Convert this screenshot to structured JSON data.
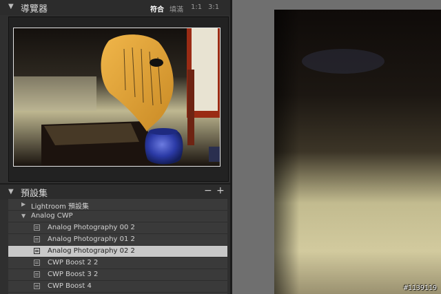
{
  "navigator": {
    "title": "導覽器",
    "zoom_options": [
      "符合",
      "填滿",
      "1:1",
      "3:1"
    ],
    "active_zoom": "符合"
  },
  "presets": {
    "title": "預設集",
    "remove_label": "−",
    "add_label": "+",
    "folders": [
      {
        "label": "Lightroom 預設集",
        "expanded": false
      },
      {
        "label": "Analog CWP",
        "expanded": true
      }
    ],
    "items": [
      {
        "label": "Analog Photography 00 2",
        "selected": false
      },
      {
        "label": "Analog Photography 01 2",
        "selected": false
      },
      {
        "label": "Analog Photography 02 2",
        "selected": true
      },
      {
        "label": "CWP Boost 2 2",
        "selected": false
      },
      {
        "label": "CWP Boost 3 2",
        "selected": false
      },
      {
        "label": "CWP Boost 4",
        "selected": false
      }
    ]
  },
  "watermark": "#1139119",
  "colors": {
    "panel_bg": "#2f2f2f",
    "selected_row": "#c8c8c8",
    "canvas_bg": "#6f6f6f"
  }
}
